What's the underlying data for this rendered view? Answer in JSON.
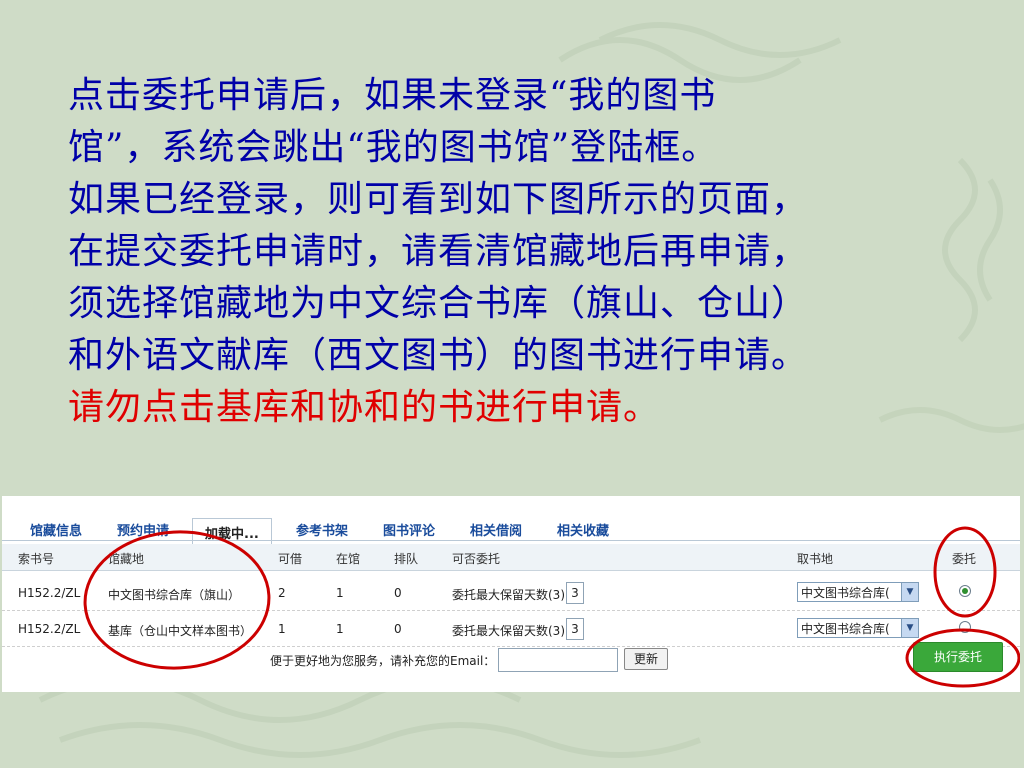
{
  "slide": {
    "lines": [
      "点击委托申请后，如果未登录“我的图书",
      "馆”，系统会跳出“我的图书馆”登陆框。",
      "如果已经登录，则可看到如下图所示的页面，",
      "在提交委托申请时，请看清馆藏地后再申请，",
      "须选择馆藏地为中文综合书库（旗山、仓山）",
      "和外语文献库（西文图书）的图书进行申请。"
    ],
    "warning": "请勿点击基库和协和的书进行申请。",
    "text_color": "#0000a8",
    "warning_color": "#e00000"
  },
  "screenshot": {
    "tabs": [
      "馆藏信息",
      "预约申请",
      "加载中...",
      "参考书架",
      "图书评论",
      "相关借阅",
      "相关收藏"
    ],
    "active_tab": "加载中...",
    "columns": [
      "索书号",
      "馆藏地",
      "可借",
      "在馆",
      "排队",
      "可否委托",
      "取书地",
      "委托"
    ],
    "rows": [
      {
        "call_number": "H152.2/ZL",
        "location": "中文图书综合库（旗山）",
        "available": "2",
        "in_library": "1",
        "queue": "0",
        "entrust": "委托最大保留天数(3)",
        "days": "3",
        "pickup": "中文图书综合库(",
        "selected": true
      },
      {
        "call_number": "H152.2/ZL",
        "location": "基库（仓山中文样本图书）",
        "available": "1",
        "in_library": "1",
        "queue": "0",
        "entrust": "委托最大保留天数(3)",
        "days": "3",
        "pickup": "中文图书综合库(",
        "selected": false
      }
    ],
    "email_prompt": "便于更好地为您服务，请补充您的Email：",
    "email_value": "",
    "refresh_label": "更新",
    "execute_label": "执行委托",
    "tab_color": "#1a4c9c",
    "button_color": "#3aa83a",
    "annotation_color": "#cc0000"
  }
}
